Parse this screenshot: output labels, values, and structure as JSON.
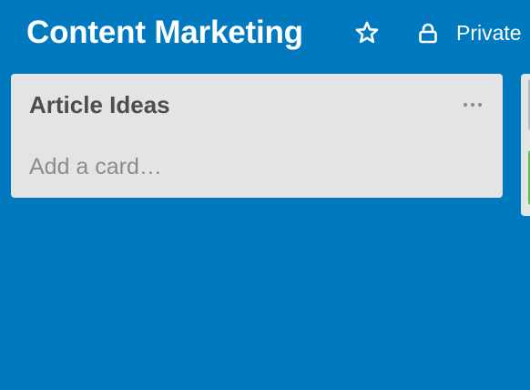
{
  "board": {
    "title": "Content Marketing",
    "visibility": "Private",
    "star_icon": "star-icon",
    "lock_icon": "lock-icon"
  },
  "lists": [
    {
      "title": "Article Ideas",
      "menu_icon": "ellipsis-icon",
      "add_card_label": "Add a card…"
    }
  ],
  "colors": {
    "board_background": "#0079bf",
    "list_background": "#e2e4e6",
    "label_green": "#61bd4f"
  }
}
